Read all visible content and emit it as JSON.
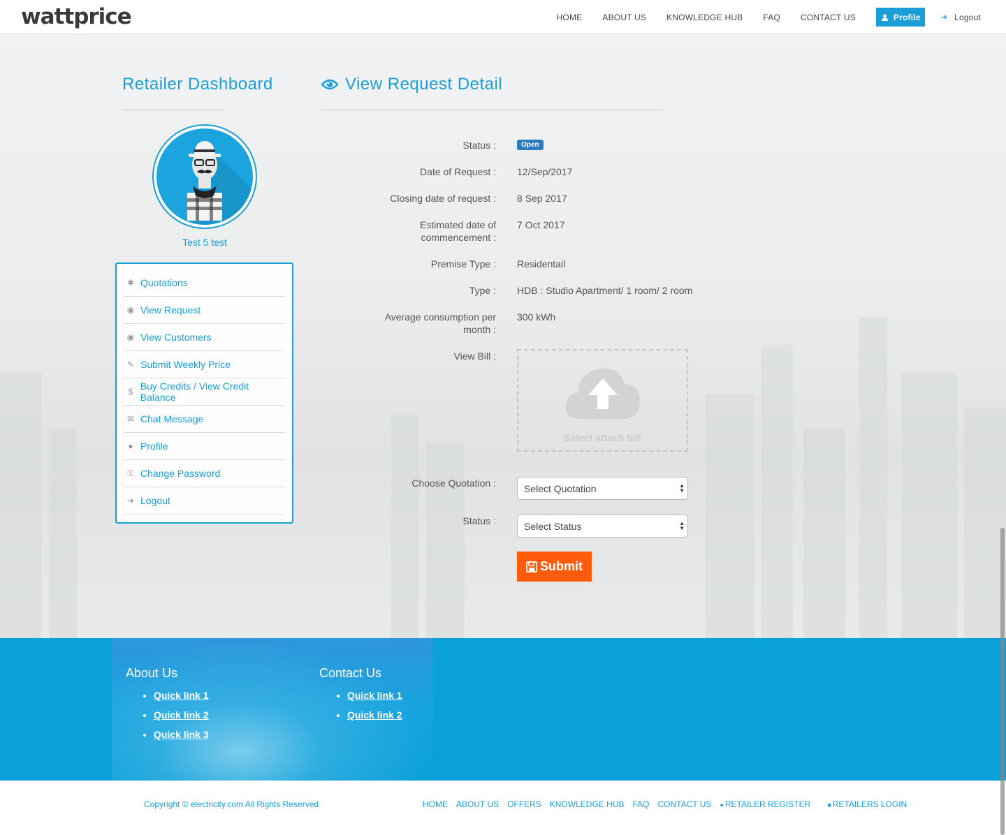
{
  "header": {
    "logo": "wattprice",
    "nav": [
      "HOME",
      "ABOUT US",
      "KNOWLEDGE HUB",
      "FAQ",
      "CONTACT US"
    ],
    "profile_label": "Profile",
    "logout_label": "Logout"
  },
  "sidebar": {
    "title": "Retailer Dashboard",
    "user_name": "Test 5 test",
    "items": [
      {
        "label": "Quotations",
        "icon": "asterisk-icon"
      },
      {
        "label": "View Request",
        "icon": "eye-icon"
      },
      {
        "label": "View Customers",
        "icon": "eye-icon"
      },
      {
        "label": "Submit Weekly Price",
        "icon": "pencil-icon"
      },
      {
        "label": "Buy Credits / View Credit Balance",
        "icon": "dollar-icon"
      },
      {
        "label": "Chat Message",
        "icon": "comments-icon"
      },
      {
        "label": "Profile",
        "icon": "user-icon"
      },
      {
        "label": "Change Password",
        "icon": "key-icon"
      },
      {
        "label": "Logout",
        "icon": "sign-out-icon"
      }
    ]
  },
  "main": {
    "title": "View Request Detail",
    "fields": {
      "status_label": "Status :",
      "status_value": "Open",
      "date_label": "Date of Request :",
      "date_value": "12/Sep/2017",
      "closing_label": "Closing date of request :",
      "closing_value": "8 Sep 2017",
      "commence_label_1": "Estimated date of",
      "commence_label_2": "commencement :",
      "commence_value": "7 Oct 2017",
      "premise_label": "Premise Type :",
      "premise_value": "Residentail",
      "type_label": "Type :",
      "type_value": "HDB : Studio Apartment/ 1 room/ 2 room",
      "consumption_label_1": "Average consumption per",
      "consumption_label_2": "month :",
      "consumption_value": "300 kWh",
      "bill_label": "View Bill :",
      "bill_placeholder": "Select attach bill",
      "quotation_label": "Choose Quotation :",
      "quotation_selected": "Select Quotation",
      "status2_label": "Status :",
      "status2_selected": "Select Status"
    },
    "submit_label": "Submit"
  },
  "footer": {
    "about_title": "About Us",
    "about_links": [
      "Quick link 1",
      "Quick link 2",
      "Quick link 3"
    ],
    "contact_title": "Contact Us",
    "contact_links": [
      "Quick link 1",
      "Quick link 2"
    ],
    "copyright": "Copyright © electricity.com All Rights Reserved",
    "bottom_nav": [
      "HOME",
      "ABOUT US",
      "OFFERS",
      "KNOWLEDGE HUB",
      "FAQ",
      "CONTACT US"
    ],
    "retailer_register": "RETAILER REGISTER",
    "retailers_login": "RETAILERS LOGIN"
  },
  "colors": {
    "accent": "#1a9ed8",
    "submit": "#ff5b0a",
    "badge": "#2b7bc0",
    "footer": "#0aa0d8"
  }
}
